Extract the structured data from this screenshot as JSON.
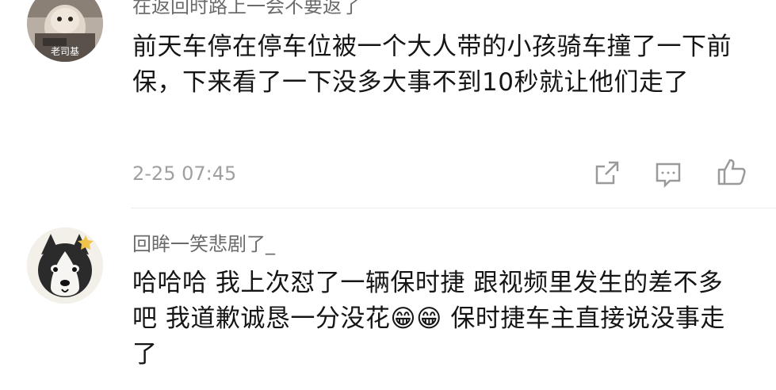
{
  "comment1": {
    "username": "在返回时路上一会不要返了",
    "avatar_badge": "老司基",
    "text": "前天车停在停车位被一个大人带的小孩骑车撞了一下前保，下来看了一下没多大事不到10秒就让他们走了",
    "time": "2-25 07:45"
  },
  "comment2": {
    "username": "回眸一笑悲剧了_",
    "text": "哈哈哈 我上次怼了一辆保时捷  跟视频里发生的差不多吧   我道歉诚恳一分没花😁😁   保时捷车主直接说没事走了"
  },
  "icons": {
    "share": "share-icon",
    "comment": "comment-icon",
    "like": "thumbs-up-icon"
  },
  "colors": {
    "text": "#151515",
    "meta": "#a0a0a0",
    "username": "#6b6b6b",
    "icon": "#9a9a9a"
  }
}
